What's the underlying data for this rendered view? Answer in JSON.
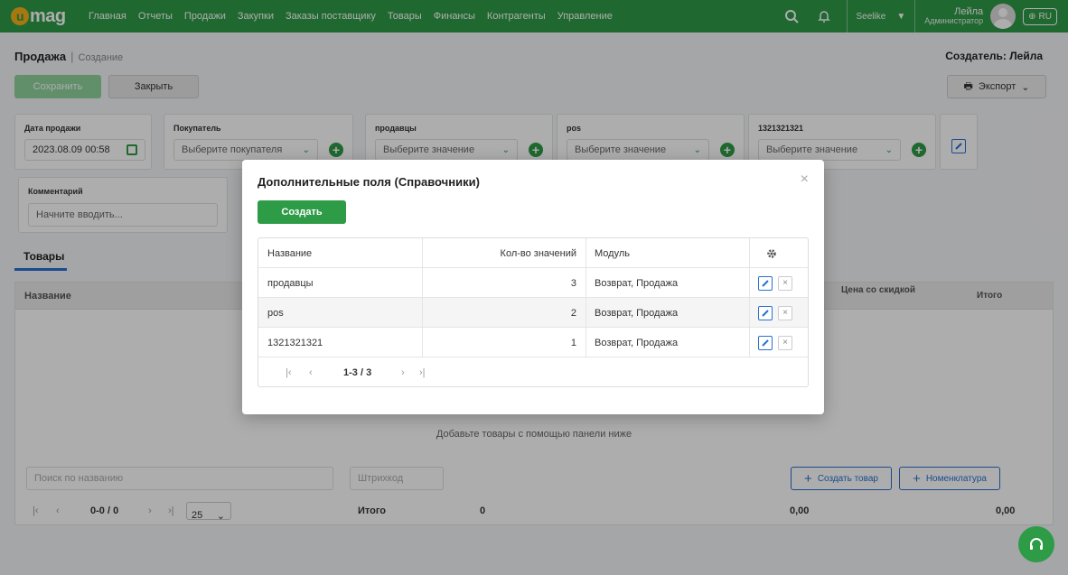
{
  "nav": {
    "logo": "mag",
    "items": [
      "Главная",
      "Отчеты",
      "Продажи",
      "Закупки",
      "Заказы поставщику",
      "Товары",
      "Финансы",
      "Контрагенты",
      "Управление"
    ],
    "store": "Seelike",
    "user_name": "Лейла",
    "user_role": "Администратор",
    "lang": "RU"
  },
  "page": {
    "title": "Продажа",
    "subtitle": "Создание",
    "creator": "Создатель: Лейла",
    "save": "Сохранить",
    "close": "Закрыть",
    "export": "Экспорт"
  },
  "fields": {
    "date_label": "Дата продажи",
    "date_value": "2023.08.09 00:58",
    "buyer_label": "Покупатель",
    "buyer_placeholder": "Выберите покупателя",
    "sellers_label": "продавцы",
    "pos_label": "pos",
    "num_label": "1321321321",
    "select_placeholder": "Выберите значение",
    "comment_label": "Комментарий",
    "comment_placeholder": "Начните вводить..."
  },
  "products": {
    "tab": "Товары",
    "col_name": "Название",
    "col_discount_price": "Цена со скидкой",
    "col_total": "Итого",
    "empty_text": "Добавьте товары с помощью панели ниже",
    "search_placeholder": "Поиск по названию",
    "barcode_placeholder": "Штрихкод",
    "create_product": "Создать товар",
    "nomenclature": "Номенклатура",
    "pager": "0-0 / 0",
    "per_page": "25",
    "total_label": "Итого",
    "total_qty": "0",
    "sum1": "0,00",
    "sum2": "0,00"
  },
  "modal": {
    "title": "Дополнительные поля (Справочники)",
    "create": "Создать",
    "headers": {
      "name": "Название",
      "count": "Кол-во значений",
      "module": "Модуль"
    },
    "rows": [
      {
        "name": "продавцы",
        "count": "3",
        "module": "Возврат, Продажа"
      },
      {
        "name": "pos",
        "count": "2",
        "module": "Возврат, Продажа"
      },
      {
        "name": "1321321321",
        "count": "1",
        "module": "Возврат, Продажа"
      }
    ],
    "pager": "1-3 / 3"
  }
}
